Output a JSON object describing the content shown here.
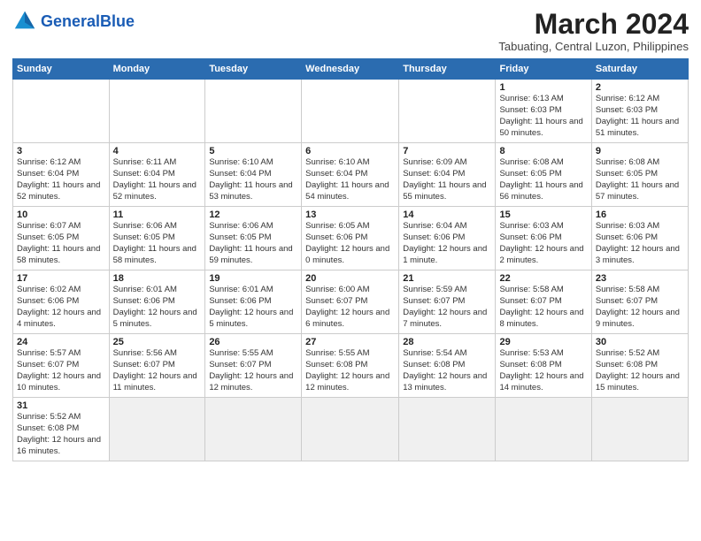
{
  "header": {
    "logo_text_general": "General",
    "logo_text_blue": "Blue",
    "main_title": "March 2024",
    "subtitle": "Tabuating, Central Luzon, Philippines"
  },
  "weekdays": [
    "Sunday",
    "Monday",
    "Tuesday",
    "Wednesday",
    "Thursday",
    "Friday",
    "Saturday"
  ],
  "weeks": [
    [
      {
        "day": "",
        "info": ""
      },
      {
        "day": "",
        "info": ""
      },
      {
        "day": "",
        "info": ""
      },
      {
        "day": "",
        "info": ""
      },
      {
        "day": "",
        "info": ""
      },
      {
        "day": "1",
        "info": "Sunrise: 6:13 AM\nSunset: 6:03 PM\nDaylight: 11 hours\nand 50 minutes."
      },
      {
        "day": "2",
        "info": "Sunrise: 6:12 AM\nSunset: 6:03 PM\nDaylight: 11 hours\nand 51 minutes."
      }
    ],
    [
      {
        "day": "3",
        "info": "Sunrise: 6:12 AM\nSunset: 6:04 PM\nDaylight: 11 hours\nand 52 minutes."
      },
      {
        "day": "4",
        "info": "Sunrise: 6:11 AM\nSunset: 6:04 PM\nDaylight: 11 hours\nand 52 minutes."
      },
      {
        "day": "5",
        "info": "Sunrise: 6:10 AM\nSunset: 6:04 PM\nDaylight: 11 hours\nand 53 minutes."
      },
      {
        "day": "6",
        "info": "Sunrise: 6:10 AM\nSunset: 6:04 PM\nDaylight: 11 hours\nand 54 minutes."
      },
      {
        "day": "7",
        "info": "Sunrise: 6:09 AM\nSunset: 6:04 PM\nDaylight: 11 hours\nand 55 minutes."
      },
      {
        "day": "8",
        "info": "Sunrise: 6:08 AM\nSunset: 6:05 PM\nDaylight: 11 hours\nand 56 minutes."
      },
      {
        "day": "9",
        "info": "Sunrise: 6:08 AM\nSunset: 6:05 PM\nDaylight: 11 hours\nand 57 minutes."
      }
    ],
    [
      {
        "day": "10",
        "info": "Sunrise: 6:07 AM\nSunset: 6:05 PM\nDaylight: 11 hours\nand 58 minutes."
      },
      {
        "day": "11",
        "info": "Sunrise: 6:06 AM\nSunset: 6:05 PM\nDaylight: 11 hours\nand 58 minutes."
      },
      {
        "day": "12",
        "info": "Sunrise: 6:06 AM\nSunset: 6:05 PM\nDaylight: 11 hours\nand 59 minutes."
      },
      {
        "day": "13",
        "info": "Sunrise: 6:05 AM\nSunset: 6:06 PM\nDaylight: 12 hours\nand 0 minutes."
      },
      {
        "day": "14",
        "info": "Sunrise: 6:04 AM\nSunset: 6:06 PM\nDaylight: 12 hours\nand 1 minute."
      },
      {
        "day": "15",
        "info": "Sunrise: 6:03 AM\nSunset: 6:06 PM\nDaylight: 12 hours\nand 2 minutes."
      },
      {
        "day": "16",
        "info": "Sunrise: 6:03 AM\nSunset: 6:06 PM\nDaylight: 12 hours\nand 3 minutes."
      }
    ],
    [
      {
        "day": "17",
        "info": "Sunrise: 6:02 AM\nSunset: 6:06 PM\nDaylight: 12 hours\nand 4 minutes."
      },
      {
        "day": "18",
        "info": "Sunrise: 6:01 AM\nSunset: 6:06 PM\nDaylight: 12 hours\nand 5 minutes."
      },
      {
        "day": "19",
        "info": "Sunrise: 6:01 AM\nSunset: 6:06 PM\nDaylight: 12 hours\nand 5 minutes."
      },
      {
        "day": "20",
        "info": "Sunrise: 6:00 AM\nSunset: 6:07 PM\nDaylight: 12 hours\nand 6 minutes."
      },
      {
        "day": "21",
        "info": "Sunrise: 5:59 AM\nSunset: 6:07 PM\nDaylight: 12 hours\nand 7 minutes."
      },
      {
        "day": "22",
        "info": "Sunrise: 5:58 AM\nSunset: 6:07 PM\nDaylight: 12 hours\nand 8 minutes."
      },
      {
        "day": "23",
        "info": "Sunrise: 5:58 AM\nSunset: 6:07 PM\nDaylight: 12 hours\nand 9 minutes."
      }
    ],
    [
      {
        "day": "24",
        "info": "Sunrise: 5:57 AM\nSunset: 6:07 PM\nDaylight: 12 hours\nand 10 minutes."
      },
      {
        "day": "25",
        "info": "Sunrise: 5:56 AM\nSunset: 6:07 PM\nDaylight: 12 hours\nand 11 minutes."
      },
      {
        "day": "26",
        "info": "Sunrise: 5:55 AM\nSunset: 6:07 PM\nDaylight: 12 hours\nand 12 minutes."
      },
      {
        "day": "27",
        "info": "Sunrise: 5:55 AM\nSunset: 6:08 PM\nDaylight: 12 hours\nand 12 minutes."
      },
      {
        "day": "28",
        "info": "Sunrise: 5:54 AM\nSunset: 6:08 PM\nDaylight: 12 hours\nand 13 minutes."
      },
      {
        "day": "29",
        "info": "Sunrise: 5:53 AM\nSunset: 6:08 PM\nDaylight: 12 hours\nand 14 minutes."
      },
      {
        "day": "30",
        "info": "Sunrise: 5:52 AM\nSunset: 6:08 PM\nDaylight: 12 hours\nand 15 minutes."
      }
    ],
    [
      {
        "day": "31",
        "info": "Sunrise: 5:52 AM\nSunset: 6:08 PM\nDaylight: 12 hours\nand 16 minutes."
      },
      {
        "day": "",
        "info": ""
      },
      {
        "day": "",
        "info": ""
      },
      {
        "day": "",
        "info": ""
      },
      {
        "day": "",
        "info": ""
      },
      {
        "day": "",
        "info": ""
      },
      {
        "day": "",
        "info": ""
      }
    ]
  ]
}
